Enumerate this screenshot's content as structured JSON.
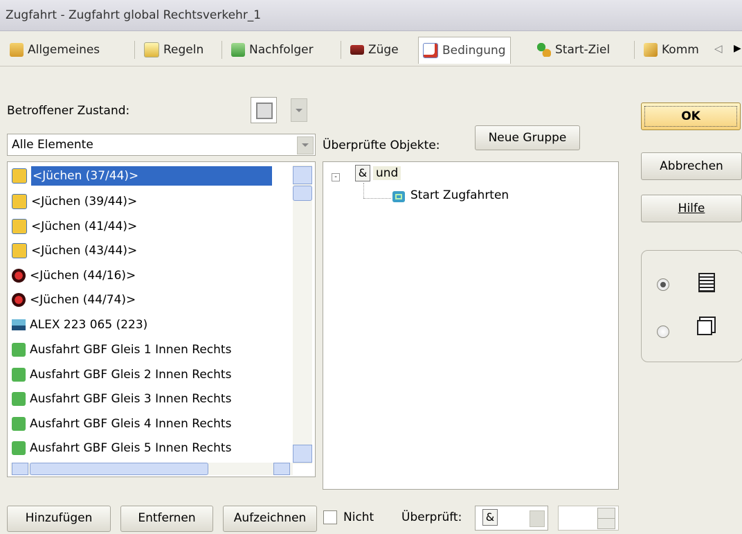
{
  "window": {
    "title": "Zugfahrt - Zugfahrt global Rechtsverkehr_1"
  },
  "tabs": [
    {
      "label": "Allgemeines",
      "icon": "general-icon"
    },
    {
      "label": "Regeln",
      "icon": "rules-icon"
    },
    {
      "label": "Nachfolger",
      "icon": "successor-icon"
    },
    {
      "label": "Züge",
      "icon": "trains-icon"
    },
    {
      "label": "Bedingung",
      "icon": "condition-icon",
      "active": true
    },
    {
      "label": "Start-Ziel",
      "icon": "start-goal-icon"
    },
    {
      "label": "Komm",
      "icon": "comment-icon"
    }
  ],
  "tab_nav": {
    "prev": "◁",
    "next": "▶"
  },
  "left": {
    "state_label": "Betroffener Zustand:",
    "filter_value": "Alle Elemente",
    "items": [
      {
        "text": "<Jüchen (37/44)>",
        "icon": "signal-yellow-icon",
        "selected": true
      },
      {
        "text": "<Jüchen (39/44)>",
        "icon": "signal-yellow-icon"
      },
      {
        "text": "<Jüchen (41/44)>",
        "icon": "signal-yellow-icon"
      },
      {
        "text": "<Jüchen (43/44)>",
        "icon": "signal-yellow-icon"
      },
      {
        "text": "<Jüchen (44/16)>",
        "icon": "signal-red-icon"
      },
      {
        "text": "<Jüchen (44/74)>",
        "icon": "signal-red-icon"
      },
      {
        "text": "ALEX 223 065 (223)",
        "icon": "locomotive-icon"
      },
      {
        "text": "Ausfahrt GBF Gleis 1 Innen Rechts",
        "icon": "exit-arrow-icon"
      },
      {
        "text": "Ausfahrt GBF Gleis 2 Innen Rechts",
        "icon": "exit-arrow-icon"
      },
      {
        "text": "Ausfahrt GBF Gleis 3 Innen Rechts",
        "icon": "exit-arrow-icon"
      },
      {
        "text": "Ausfahrt GBF Gleis 4 Innen Rechts",
        "icon": "exit-arrow-icon"
      },
      {
        "text": "Ausfahrt GBF Gleis 5 Innen Rechts",
        "icon": "exit-arrow-icon"
      }
    ]
  },
  "middle": {
    "objects_label": "Überprüfte Objekte:",
    "new_group": "Neue Gruppe",
    "tree_root": {
      "op": "&",
      "label": "und"
    },
    "tree_child": "Start Zugfahrten"
  },
  "right": {
    "ok": "OK",
    "cancel": "Abbrechen",
    "help": "Hilfe"
  },
  "bottom": {
    "add": "Hinzufügen",
    "remove": "Entfernen",
    "record": "Aufzeichnen",
    "not_label": "Nicht",
    "checked_label": "Überprüft:",
    "checked_value": "&"
  },
  "colors": {
    "selection": "#316ac5",
    "ok_bg": "#f7d27c",
    "panel_bg": "#eeede5"
  }
}
